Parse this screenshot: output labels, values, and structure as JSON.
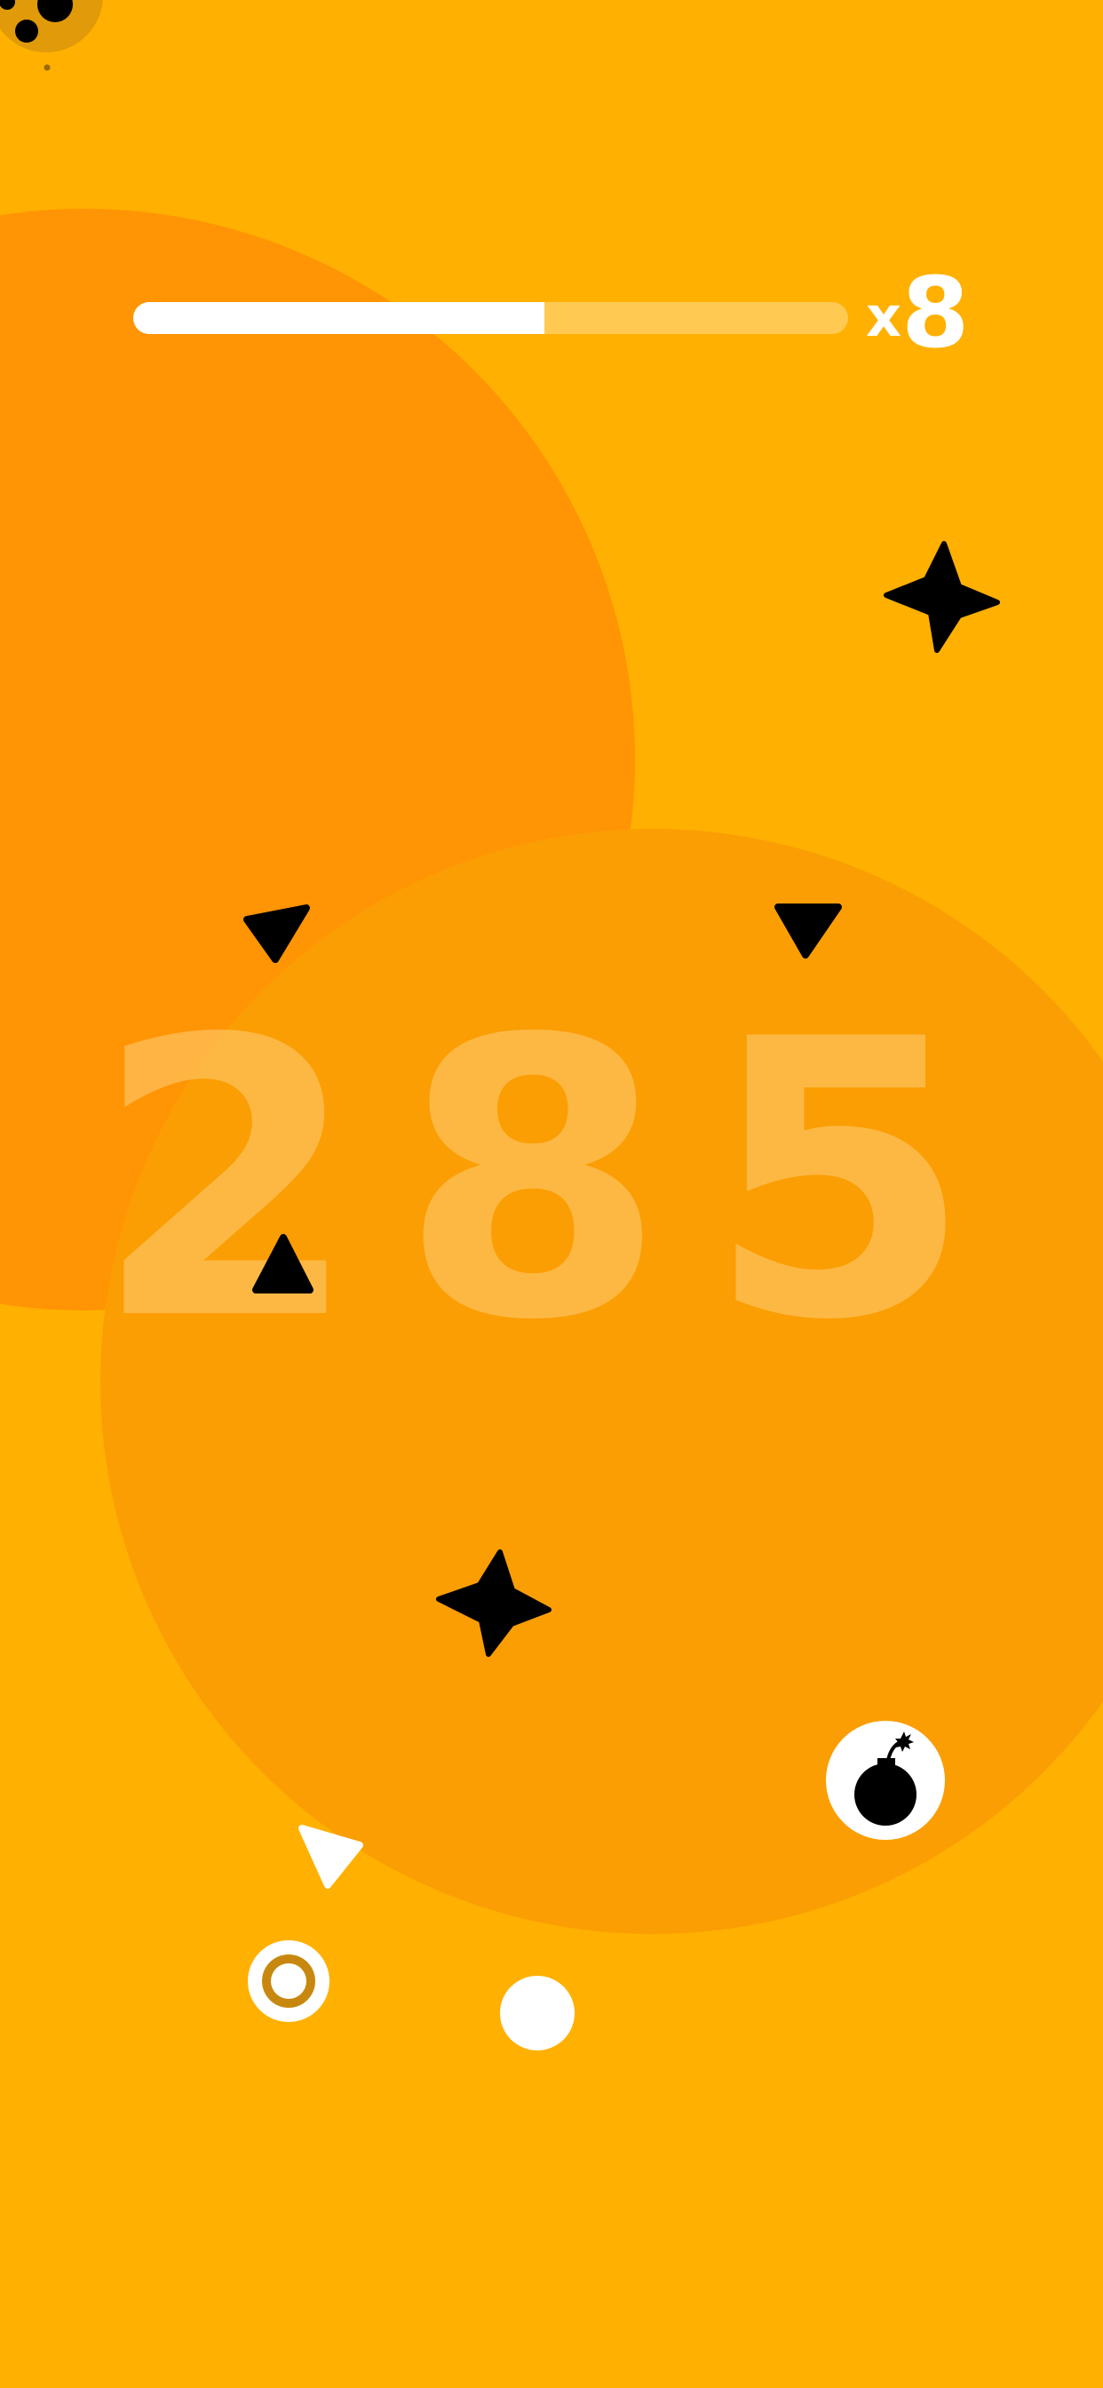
{
  "hud": {
    "multiplier_prefix": "x",
    "multiplier_value": "8",
    "progress_fraction": 0.575
  },
  "score": {
    "digits": [
      "2",
      "8",
      "5"
    ]
  },
  "controls": {
    "bomb_icon": "bomb-icon"
  },
  "colors": {
    "background": "#FFB000",
    "circle_left": "#FF9404",
    "circle_center": "#FB9E04",
    "enemy": "#000000",
    "player": "#FFFFFF"
  }
}
